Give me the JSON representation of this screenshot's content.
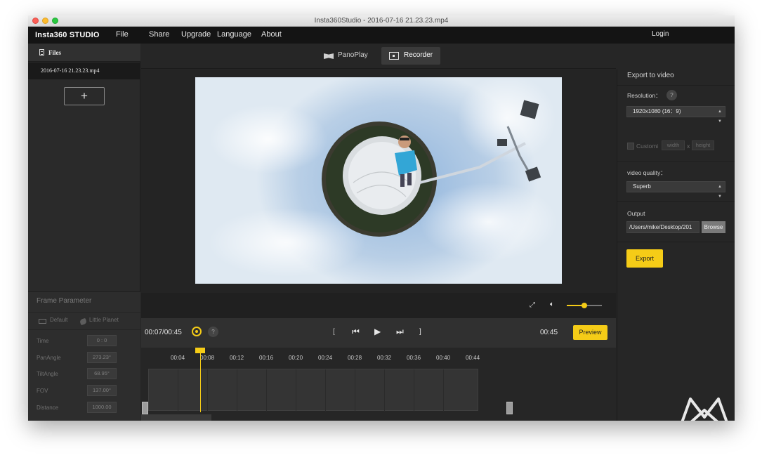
{
  "window": {
    "title": "Insta360Studio - 2016-07-16 21.23.23.mp4"
  },
  "menubar": {
    "brand": "Insta360 STUDIO",
    "items": [
      "File",
      "Share",
      "Upgrade",
      "Language",
      "About"
    ],
    "login": "Login"
  },
  "left": {
    "files_label": "Files",
    "file_name": "2016-07-16 21.23.23.mp4",
    "add_label": "+",
    "frame": {
      "title": "Frame Parameter",
      "modes": [
        "Default",
        "Little Planet"
      ],
      "params": [
        {
          "label": "Time",
          "value": "0 : 0"
        },
        {
          "label": "PanAngle",
          "value": "273.23°"
        },
        {
          "label": "TiltAngle",
          "value": "68.95°"
        },
        {
          "label": "FOV",
          "value": "137.00°"
        },
        {
          "label": "Distance",
          "value": "1000.00"
        }
      ]
    }
  },
  "tabs": {
    "panoplay": "PanoPlay",
    "recorder": "Recorder",
    "active": "Recorder"
  },
  "player": {
    "current_time": "00:07/00:45",
    "help": "?",
    "total_time": "00:45",
    "preview_label": "Preview",
    "volume_level": 0.5,
    "buttons": {
      "mark_in": "[",
      "prev": "⏮",
      "play": "▶",
      "next": "⏭",
      "mark_out": "]"
    }
  },
  "timeline": {
    "ticks": [
      "00:04",
      "00:08",
      "00:12",
      "00:16",
      "00:20",
      "00:24",
      "00:28",
      "00:32",
      "00:36",
      "00:40",
      "00:44"
    ],
    "playhead_time": "00:07"
  },
  "export": {
    "title": "Export to video",
    "resolution_label": "Resolution：",
    "resolution_value": "1920x1080 (16：9)",
    "custom_label": "Customi",
    "width_placeholder": "width",
    "x_sep": "x",
    "height_placeholder": "height",
    "quality_label": "video quality：",
    "quality_value": "Superb",
    "output_label": "Output",
    "output_path": "/Users/mike/Desktop/201",
    "browse_label": "Browse",
    "export_label": "Export"
  },
  "colors": {
    "accent": "#f5cc17",
    "bg": "#262626",
    "menubar": "#141414"
  }
}
